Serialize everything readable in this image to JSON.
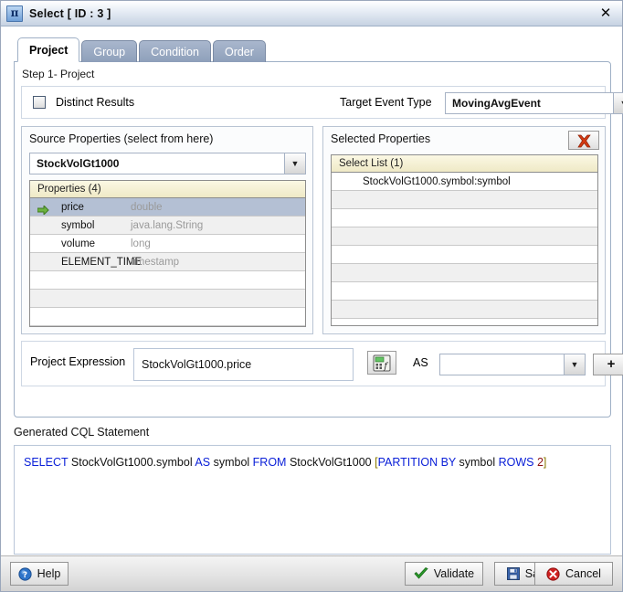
{
  "window": {
    "icon": "pi-operator-icon",
    "title": "Select [ ID : 3 ]",
    "close_label": "✕"
  },
  "tabs": [
    {
      "label": "Project",
      "active": true
    },
    {
      "label": "Group",
      "active": false
    },
    {
      "label": "Condition",
      "active": false
    },
    {
      "label": "Order",
      "active": false
    }
  ],
  "project": {
    "step_label": "Step 1- Project",
    "distinct": {
      "label": "Distinct Results",
      "checked": false
    },
    "target_event_type": {
      "label": "Target Event Type",
      "value": "MovingAvgEvent",
      "arrow": "▼"
    },
    "source": {
      "title": "Source Properties (select from here)",
      "stream": "StockVolGt1000",
      "arrow": "▼",
      "list_header": "Properties (4)",
      "rows": [
        {
          "name": "price",
          "type": "double",
          "selected": true
        },
        {
          "name": "symbol",
          "type": "java.lang.String",
          "selected": false
        },
        {
          "name": "volume",
          "type": "long",
          "selected": false
        },
        {
          "name": "ELEMENT_TIME",
          "type": "timestamp",
          "selected": false
        },
        {
          "name": "",
          "type": "",
          "selected": false
        },
        {
          "name": "",
          "type": "",
          "selected": false
        },
        {
          "name": "",
          "type": "",
          "selected": false
        }
      ]
    },
    "selected": {
      "title": "Selected Properties",
      "delete_icon": "red-x-icon",
      "list_header": "Select List (1)",
      "rows": [
        "StockVolGt1000.symbol:symbol",
        "",
        "",
        "",
        "",
        "",
        "",
        "",
        ""
      ]
    },
    "expression": {
      "label": "Project Expression",
      "value": "StockVolGt1000.price",
      "placeholder": "",
      "fx_icon": "function-builder-icon",
      "as_label": "AS",
      "as_value": "",
      "as_placeholder": "",
      "as_arrow": "▼",
      "add_label": "+"
    }
  },
  "cql": {
    "label": "Generated CQL Statement",
    "tokens": [
      {
        "t": "SELECT",
        "c": "kw"
      },
      {
        "t": "StockVolGt1000.symbol",
        "c": "plain"
      },
      {
        "t": "AS",
        "c": "kw"
      },
      {
        "t": "symbol",
        "c": "plain"
      },
      {
        "t": "FROM",
        "c": "kw"
      },
      {
        "t": "StockVolGt1000",
        "c": "plain"
      },
      {
        "t": " [",
        "c": "brk"
      },
      {
        "t": "PARTITION BY",
        "c": "kw"
      },
      {
        "t": "symbol",
        "c": "plain"
      },
      {
        "t": " ROWS",
        "c": "kw"
      },
      {
        "t": "2",
        "c": "num"
      },
      {
        "t": "]",
        "c": "brk"
      }
    ],
    "text": "SELECT StockVolGt1000.symbol AS symbol FROM StockVolGt1000  [PARTITION BY symbol  ROWS 2]"
  },
  "footer": {
    "help": "Help",
    "validate": "Validate",
    "save": "Save",
    "cancel": "Cancel"
  },
  "colors": {
    "titlebar_accent": "#c6d2e2",
    "tab_inactive": "#8e9fba",
    "list_header": "#efe9c6",
    "row_selected": "#b4c0d4",
    "keyword": "#0b20d8",
    "bracket": "#8a7a00",
    "number": "#8a1010",
    "delete_x": "#d43a12",
    "validate_check": "#2a9a2a",
    "save_disk": "#3a66b0",
    "cancel_circle": "#cf2020"
  }
}
